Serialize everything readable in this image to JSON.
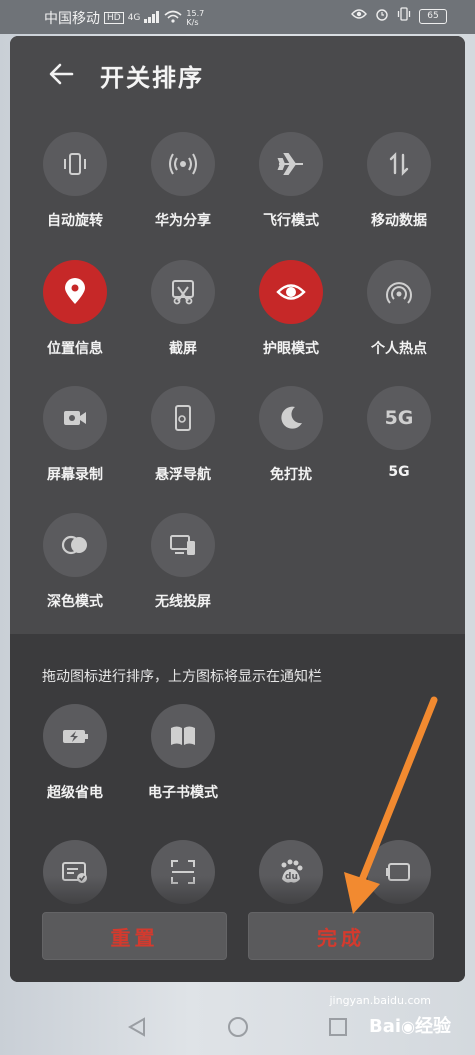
{
  "status": {
    "carrier": "中国移动",
    "hd": "HD",
    "network": "4G",
    "speed_top": "15.7",
    "speed_bottom": "K/s",
    "battery": "65"
  },
  "header": {
    "title": "开关排序"
  },
  "tiles_active": [
    {
      "label": "自动旋转",
      "icon": "auto-rotate-icon",
      "active": false
    },
    {
      "label": "华为分享",
      "icon": "huawei-share-icon",
      "active": false
    },
    {
      "label": "飞行模式",
      "icon": "airplane-icon",
      "active": false
    },
    {
      "label": "移动数据",
      "icon": "mobile-data-icon",
      "active": false
    },
    {
      "label": "位置信息",
      "icon": "location-icon",
      "active": true
    },
    {
      "label": "截屏",
      "icon": "screenshot-icon",
      "active": false
    },
    {
      "label": "护眼模式",
      "icon": "eye-icon",
      "active": true
    },
    {
      "label": "个人热点",
      "icon": "hotspot-icon",
      "active": false
    },
    {
      "label": "屏幕录制",
      "icon": "screen-record-icon",
      "active": false
    },
    {
      "label": "悬浮导航",
      "icon": "floating-nav-icon",
      "active": false
    },
    {
      "label": "免打扰",
      "icon": "moon-icon",
      "active": false
    },
    {
      "label": "5G",
      "icon": "5g-icon",
      "active": false,
      "glyph": "5G"
    },
    {
      "label": "深色模式",
      "icon": "dark-mode-icon",
      "active": false
    },
    {
      "label": "无线投屏",
      "icon": "wireless-projection-icon",
      "active": false
    }
  ],
  "hint": "拖动图标进行排序，上方图标将显示在通知栏",
  "tiles_inactive": [
    {
      "label": "超级省电",
      "icon": "super-power-save-icon"
    },
    {
      "label": "电子书模式",
      "icon": "ebook-icon"
    }
  ],
  "tiles_partial": [
    {
      "icon": "nfc-card-icon"
    },
    {
      "icon": "scan-icon"
    },
    {
      "icon": "baidu-icon",
      "glyph": "du"
    },
    {
      "icon": "projector-icon"
    }
  ],
  "buttons": {
    "reset": "重置",
    "done": "完成"
  },
  "colors": {
    "accent": "#d43a2e",
    "active_tile": "#c62828",
    "arrow": "#f28a30"
  },
  "watermark": {
    "brand": "Bai",
    "brand_cn": "经验",
    "site": "jingyan.baidu.com"
  }
}
